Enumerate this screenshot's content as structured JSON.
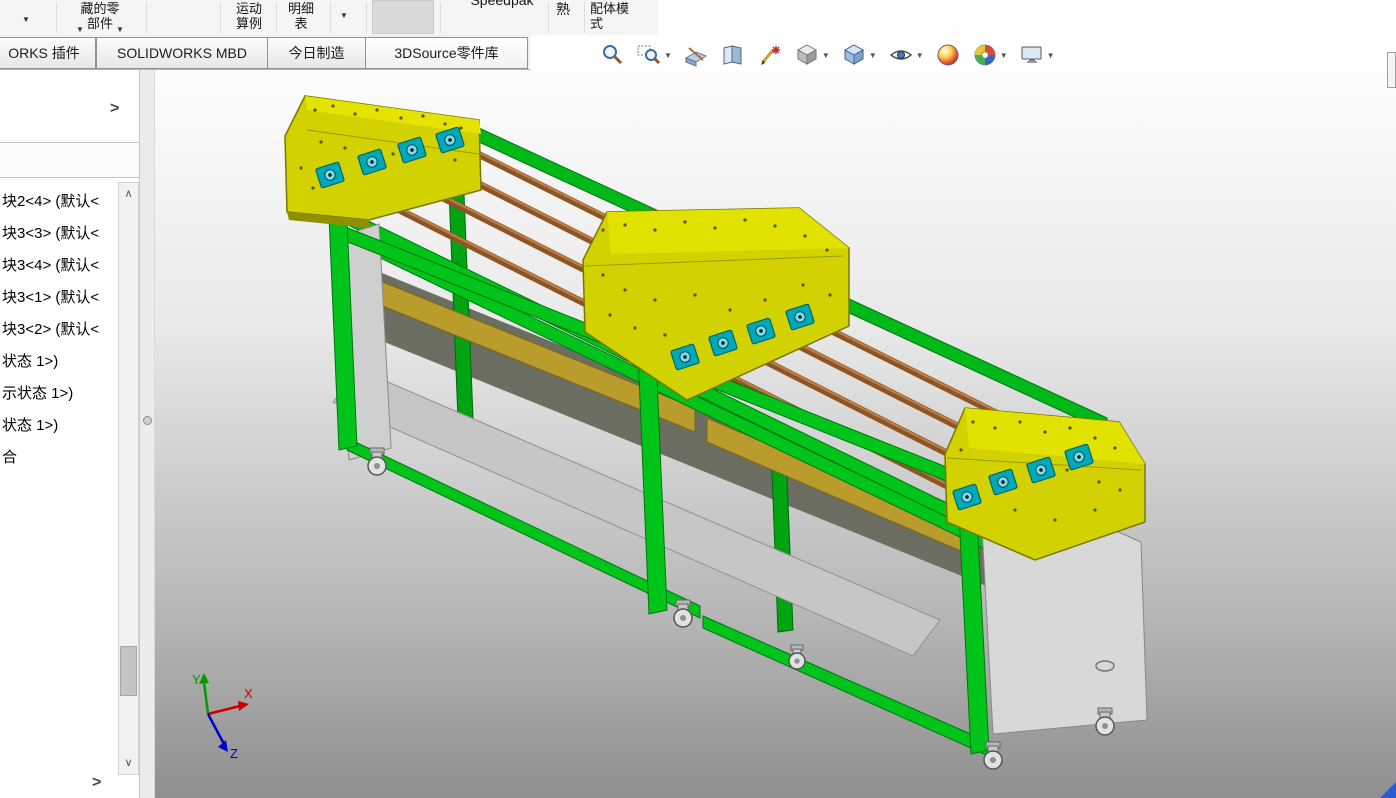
{
  "ribbon": {
    "hidden_components": {
      "line1": "藏的零",
      "line2": "部件"
    },
    "motion_study": {
      "line1": "运动",
      "line2": "算例"
    },
    "bom": {
      "line1": "明细",
      "line2": "表"
    },
    "speedpak": "Speedpak",
    "fragment": "熟",
    "assembly_mode": {
      "line1": "配体模",
      "line2": "式"
    }
  },
  "tabs": {
    "items": [
      {
        "label": "ORKS 插件"
      },
      {
        "label": "SOLIDWORKS MBD"
      },
      {
        "label": "今日制造"
      },
      {
        "label": "3DSource零件库"
      }
    ]
  },
  "feature_tree": {
    "items": [
      {
        "label": "块2<4> (默认<"
      },
      {
        "label": "块3<3> (默认<"
      },
      {
        "label": "块3<4> (默认<"
      },
      {
        "label": "块3<1> (默认<"
      },
      {
        "label": "块3<2> (默认<"
      },
      {
        "label": "状态 1>)"
      },
      {
        "label": "示状态 1>)"
      },
      {
        "label": "状态 1>)"
      },
      {
        "label": "合"
      }
    ]
  },
  "hud": {
    "buttons": [
      "zoom-fit",
      "zoom-area",
      "section-view",
      "orientation-pages",
      "edit-sketch",
      "display-style",
      "view-orientation-cube",
      "hide-show-items",
      "edit-appearance",
      "apply-scene",
      "view-settings"
    ]
  },
  "triad": {
    "x": "X",
    "y": "Y",
    "z": "Z"
  },
  "glyphs": {
    "caret_down": "▼",
    "chevron_right": ">",
    "scroll_up": "∧",
    "scroll_down": "∨"
  },
  "colors": {
    "frame_green": "#00c41a",
    "housing_yellow": "#d2d200",
    "rod_brown": "#9a5a28",
    "bearing_teal": "#00a9b6",
    "panel_gray": "#d6d6d6"
  }
}
